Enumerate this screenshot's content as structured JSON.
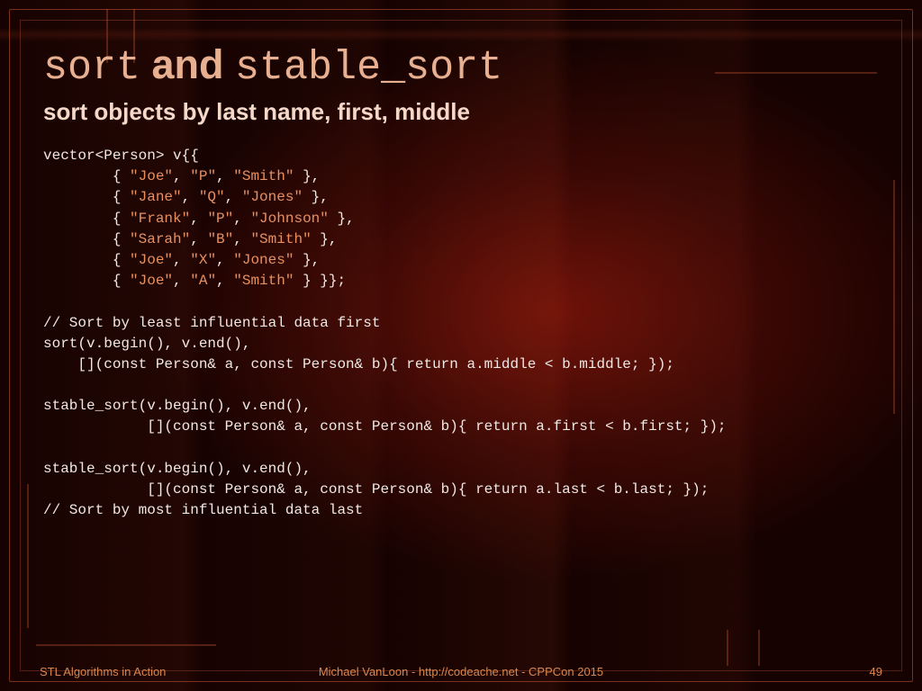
{
  "title": {
    "part1": "sort",
    "and": " and ",
    "part2": "stable_sort"
  },
  "subtitle": "sort objects by last name, first, middle",
  "code": {
    "l01a": "vector<Person> v{{",
    "l02a": "        { ",
    "l02s1": "\"Joe\"",
    "l02b": ", ",
    "l02s2": "\"P\"",
    "l02c": ", ",
    "l02s3": "\"Smith\"",
    "l02d": " },",
    "l03a": "        { ",
    "l03s1": "\"Jane\"",
    "l03b": ", ",
    "l03s2": "\"Q\"",
    "l03c": ", ",
    "l03s3": "\"Jones\"",
    "l03d": " },",
    "l04a": "        { ",
    "l04s1": "\"Frank\"",
    "l04b": ", ",
    "l04s2": "\"P\"",
    "l04c": ", ",
    "l04s3": "\"Johnson\"",
    "l04d": " },",
    "l05a": "        { ",
    "l05s1": "\"Sarah\"",
    "l05b": ", ",
    "l05s2": "\"B\"",
    "l05c": ", ",
    "l05s3": "\"Smith\"",
    "l05d": " },",
    "l06a": "        { ",
    "l06s1": "\"Joe\"",
    "l06b": ", ",
    "l06s2": "\"X\"",
    "l06c": ", ",
    "l06s3": "\"Jones\"",
    "l06d": " },",
    "l07a": "        { ",
    "l07s1": "\"Joe\"",
    "l07b": ", ",
    "l07s2": "\"A\"",
    "l07c": ", ",
    "l07s3": "\"Smith\"",
    "l07d": " } }};",
    "l08": "",
    "l09": "// Sort by least influential data first",
    "l10": "sort(v.begin(), v.end(),",
    "l11": "    [](const Person& a, const Person& b){ return a.middle < b.middle; });",
    "l12": "",
    "l13": "stable_sort(v.begin(), v.end(),",
    "l14": "            [](const Person& a, const Person& b){ return a.first < b.first; });",
    "l15": "",
    "l16": "stable_sort(v.begin(), v.end(),",
    "l17": "            [](const Person& a, const Person& b){ return a.last < b.last; });",
    "l18": "// Sort by most influential data last"
  },
  "footer": {
    "left": "STL Algorithms in Action",
    "center": "Michael VanLoon - http://codeache.net - CPPCon 2015",
    "right": "49"
  }
}
